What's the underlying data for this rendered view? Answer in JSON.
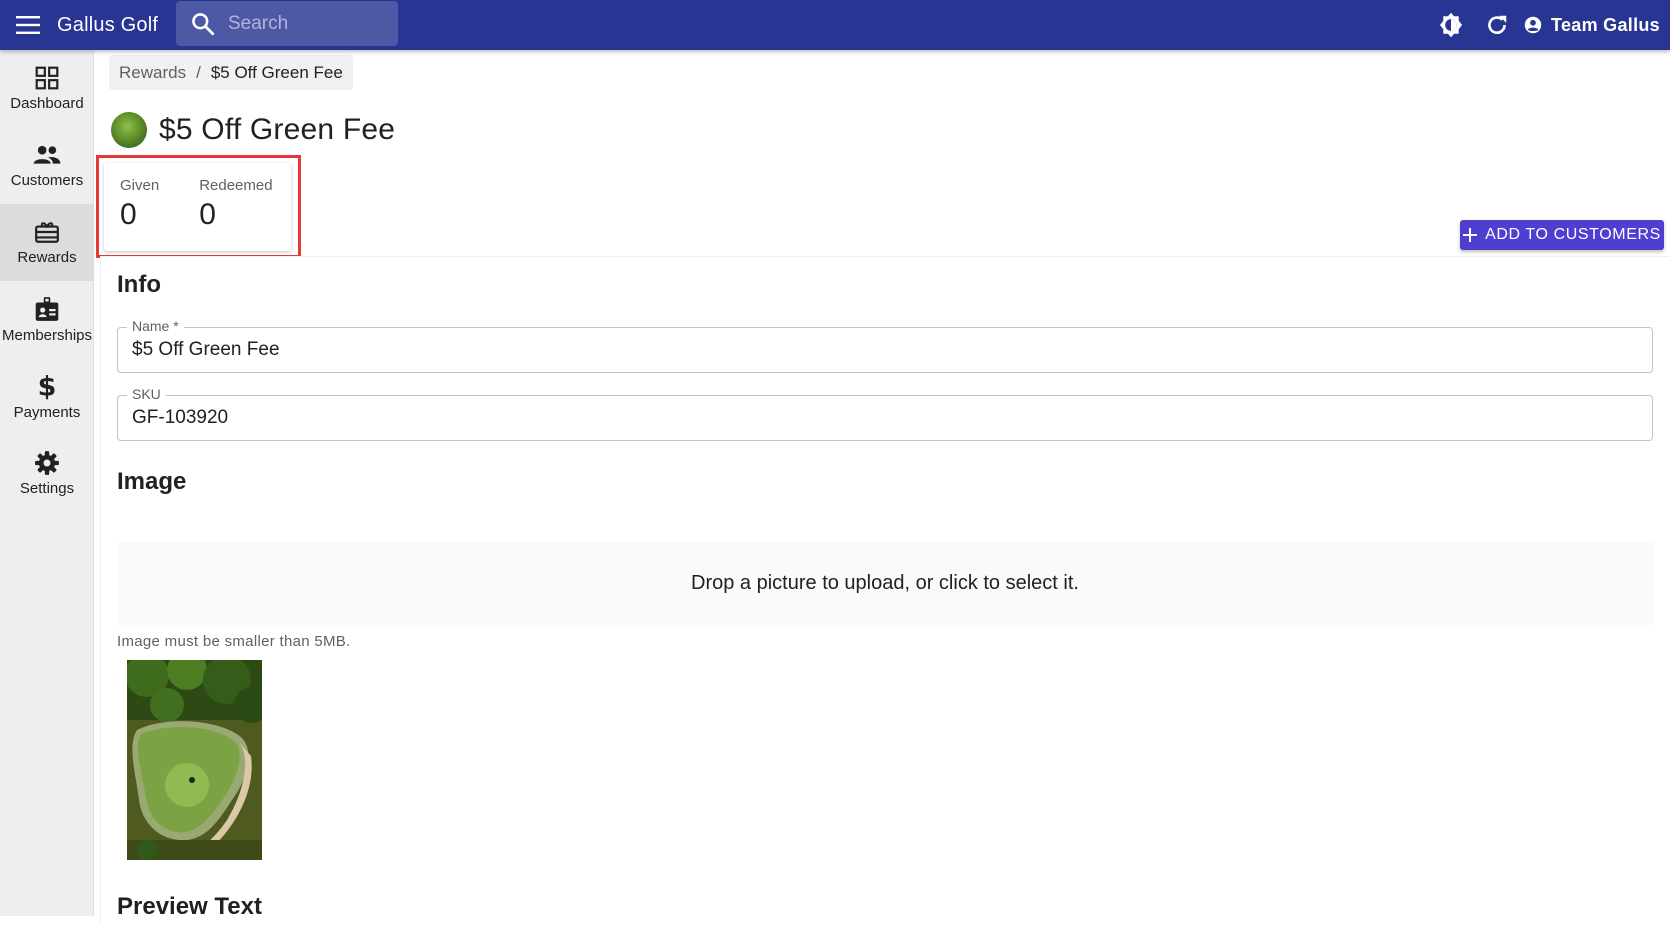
{
  "appbar": {
    "title": "Gallus Golf",
    "search_placeholder": "Search",
    "user_label": "Team Gallus",
    "icons": [
      "menu-icon",
      "search-icon",
      "brightness-icon",
      "refresh-icon",
      "account-circle-icon"
    ],
    "color": "#283593"
  },
  "sidebar": {
    "items": [
      {
        "label": "Dashboard",
        "icon": "dashboard-icon"
      },
      {
        "label": "Customers",
        "icon": "people-icon"
      },
      {
        "label": "Rewards",
        "icon": "gift-card-icon",
        "active": true
      },
      {
        "label": "Memberships",
        "icon": "badge-icon"
      },
      {
        "label": "Payments",
        "icon": "dollar-icon"
      },
      {
        "label": "Settings",
        "icon": "gear-icon"
      }
    ]
  },
  "breadcrumb": {
    "parent": "Rewards",
    "separator": "/",
    "current": "$5 Off Green Fee"
  },
  "page": {
    "title": "$5 Off Green Fee"
  },
  "stats": {
    "given_label": "Given",
    "given_value": "0",
    "redeemed_label": "Redeemed",
    "redeemed_value": "0",
    "highlight_color": "#e53935"
  },
  "actions": {
    "add_to_customers": "ADD TO CUSTOMERS",
    "color": "#4f3fd1"
  },
  "info": {
    "title": "Info",
    "name_label": "Name *",
    "name_value": "$5 Off Green Fee",
    "sku_label": "SKU",
    "sku_value": "GF-103920"
  },
  "image": {
    "title": "Image",
    "dropzone_text": "Drop a picture to upload, or click to select it.",
    "helper_text": "Image must be smaller than 5MB."
  },
  "preview": {
    "title": "Preview Text"
  }
}
